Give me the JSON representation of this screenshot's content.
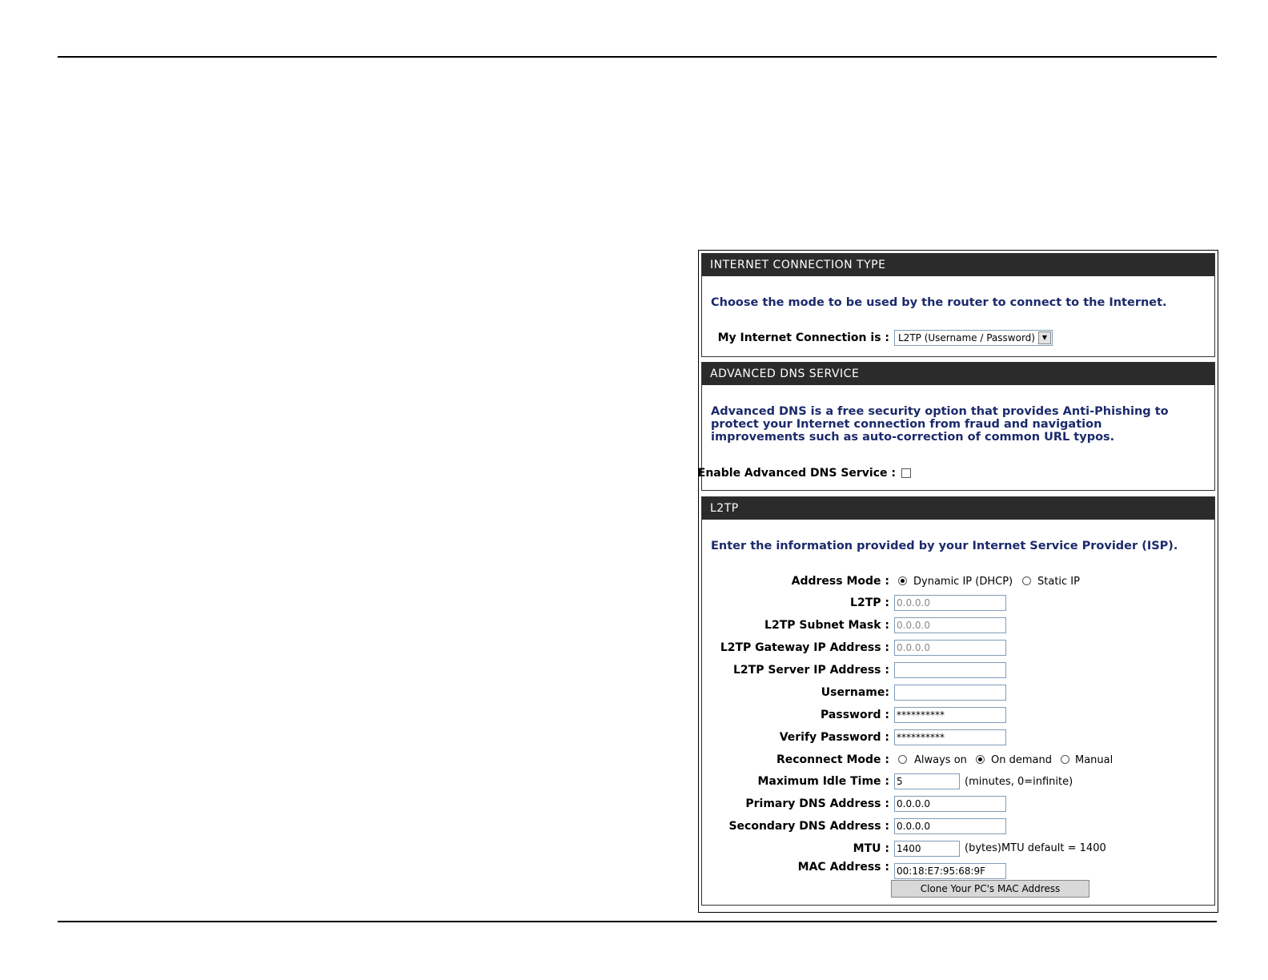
{
  "connection_type": {
    "header": "INTERNET CONNECTION TYPE",
    "intro": "Choose the mode to be used by the router to connect to the Internet.",
    "label": "My Internet Connection is :",
    "selected": "L2TP (Username / Password)"
  },
  "adv_dns": {
    "header": "ADVANCED DNS SERVICE",
    "intro": "Advanced DNS is a free security option that provides Anti-Phishing to protect your Internet connection from fraud and navigation improvements such as auto-correction of common URL typos.",
    "label": "Enable Advanced DNS Service :",
    "enabled": false
  },
  "l2tp": {
    "header": "L2TP",
    "intro": "Enter the information provided by your Internet Service Provider (ISP).",
    "address_mode": {
      "label": "Address Mode :",
      "dynamic": "Dynamic IP (DHCP)",
      "static": "Static IP",
      "selected": "dynamic"
    },
    "ip": {
      "label": "L2TP :",
      "value": "0.0.0.0"
    },
    "subnet": {
      "label": "L2TP Subnet Mask :",
      "value": "0.0.0.0"
    },
    "gateway": {
      "label": "L2TP Gateway IP Address :",
      "value": "0.0.0.0"
    },
    "server": {
      "label": "L2TP Server IP Address :",
      "value": ""
    },
    "username": {
      "label": "Username:",
      "value": ""
    },
    "password": {
      "label": "Password :",
      "value": "**********"
    },
    "verify_password": {
      "label": "Verify Password :",
      "value": "**********"
    },
    "reconnect": {
      "label": "Reconnect Mode :",
      "always": "Always on",
      "demand": "On demand",
      "manual": "Manual",
      "selected": "demand"
    },
    "idle": {
      "label": "Maximum Idle Time :",
      "value": "5",
      "note": "(minutes, 0=infinite)"
    },
    "primary_dns": {
      "label": "Primary DNS Address :",
      "value": "0.0.0.0"
    },
    "secondary_dns": {
      "label": "Secondary DNS Address :",
      "value": "0.0.0.0"
    },
    "mtu": {
      "label": "MTU :",
      "value": "1400",
      "note": "(bytes)MTU default = 1400"
    },
    "mac": {
      "label": "MAC Address :",
      "value": "00:18:E7:95:68:9F"
    },
    "clone_button": "Clone Your PC's MAC Address"
  }
}
